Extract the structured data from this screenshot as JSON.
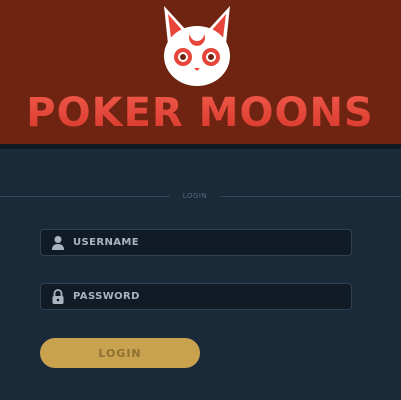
{
  "brand": {
    "name": "POKER MOONS",
    "header_color": "#6e2411",
    "logo_color": "#e8453a"
  },
  "section": {
    "label": "LOGIN"
  },
  "form": {
    "username": {
      "placeholder": "USERNAME",
      "value": "",
      "icon": "user-icon"
    },
    "password": {
      "placeholder": "PASSWORD",
      "value": "",
      "icon": "lock-icon"
    },
    "submit_label": "LOGIN",
    "submit_color": "#c8a24e"
  }
}
